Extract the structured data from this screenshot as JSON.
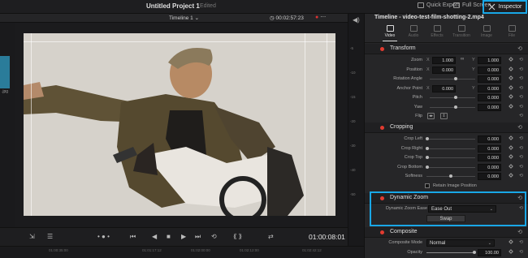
{
  "topbar": {
    "project_title": "Untitled Project 1",
    "edited": "Edited",
    "quick_export": "Quick Export",
    "full_screen": "Full Screen",
    "inspector": "Inspector"
  },
  "viewer_bar": {
    "timeline_select": "Timeline 1",
    "timecode": "00:02:57:23"
  },
  "media": {
    "thumb_label": ".jpg"
  },
  "transport": {
    "timecode": "01:00:08:01",
    "ruler_ticks": [
      "01:00:35:00",
      "01:01:17:12",
      "01:02:00:00",
      "01:02:12:00",
      "01:02:42:12"
    ]
  },
  "inspector": {
    "clip_title": "Timeline - video-test-film-shotting-2.mp4",
    "tabs": [
      "Video",
      "Audio",
      "Effects",
      "Transition",
      "Image",
      "File"
    ],
    "transform": {
      "title": "Transform",
      "zoom_label": "Zoom",
      "zoom_x": "1.000",
      "zoom_y": "1.000",
      "position_label": "Position",
      "position_x": "0.000",
      "position_y": "0.000",
      "rotation_label": "Rotation Angle",
      "rotation": "0.000",
      "anchor_label": "Anchor Point",
      "anchor_x": "0.000",
      "anchor_y": "0.000",
      "pitch_label": "Pitch",
      "pitch": "0.000",
      "yaw_label": "Yaw",
      "yaw": "0.000",
      "flip_label": "Flip",
      "x_axis": "X",
      "y_axis": "Y"
    },
    "cropping": {
      "title": "Cropping",
      "crop_left_label": "Crop Left",
      "crop_left": "0.000",
      "crop_right_label": "Crop Right",
      "crop_right": "0.000",
      "crop_top_label": "Crop Top",
      "crop_top": "0.000",
      "crop_bottom_label": "Crop Bottom",
      "crop_bottom": "0.000",
      "softness_label": "Softness",
      "softness": "0.000",
      "retain_label": "Retain Image Position"
    },
    "dynamic_zoom": {
      "title": "Dynamic Zoom",
      "ease_label": "Dynamic Zoom Ease",
      "ease_value": "Ease Out",
      "swap_label": "Swap"
    },
    "composite": {
      "title": "Composite",
      "mode_label": "Composite Mode",
      "mode_value": "Normal",
      "opacity_label": "Opacity",
      "opacity": "100.00"
    }
  },
  "colors": {
    "accent": "#19a7e6",
    "enable_dot": "#e23b30"
  }
}
